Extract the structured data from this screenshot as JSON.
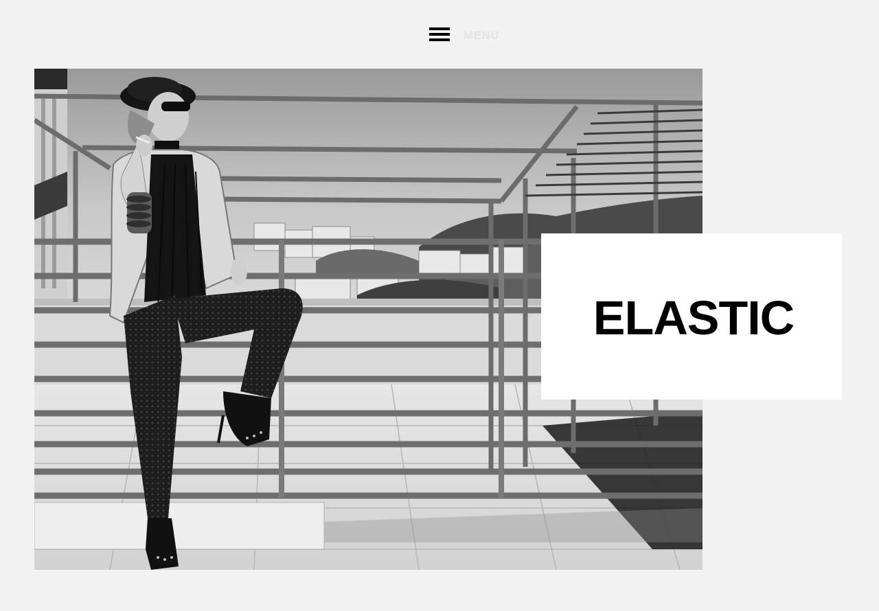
{
  "header": {
    "menu_icon": "hamburger-icon",
    "menu_label": "MENU"
  },
  "hero": {
    "image_alt": "",
    "tone": "black-and-white"
  },
  "title_card": {
    "title": "ELASTIC"
  },
  "colors": {
    "background": "#f2f2f2",
    "menu_icon": "#000000",
    "menu_label": "#e3e3e3",
    "card": "#ffffff",
    "title": "#000000"
  }
}
